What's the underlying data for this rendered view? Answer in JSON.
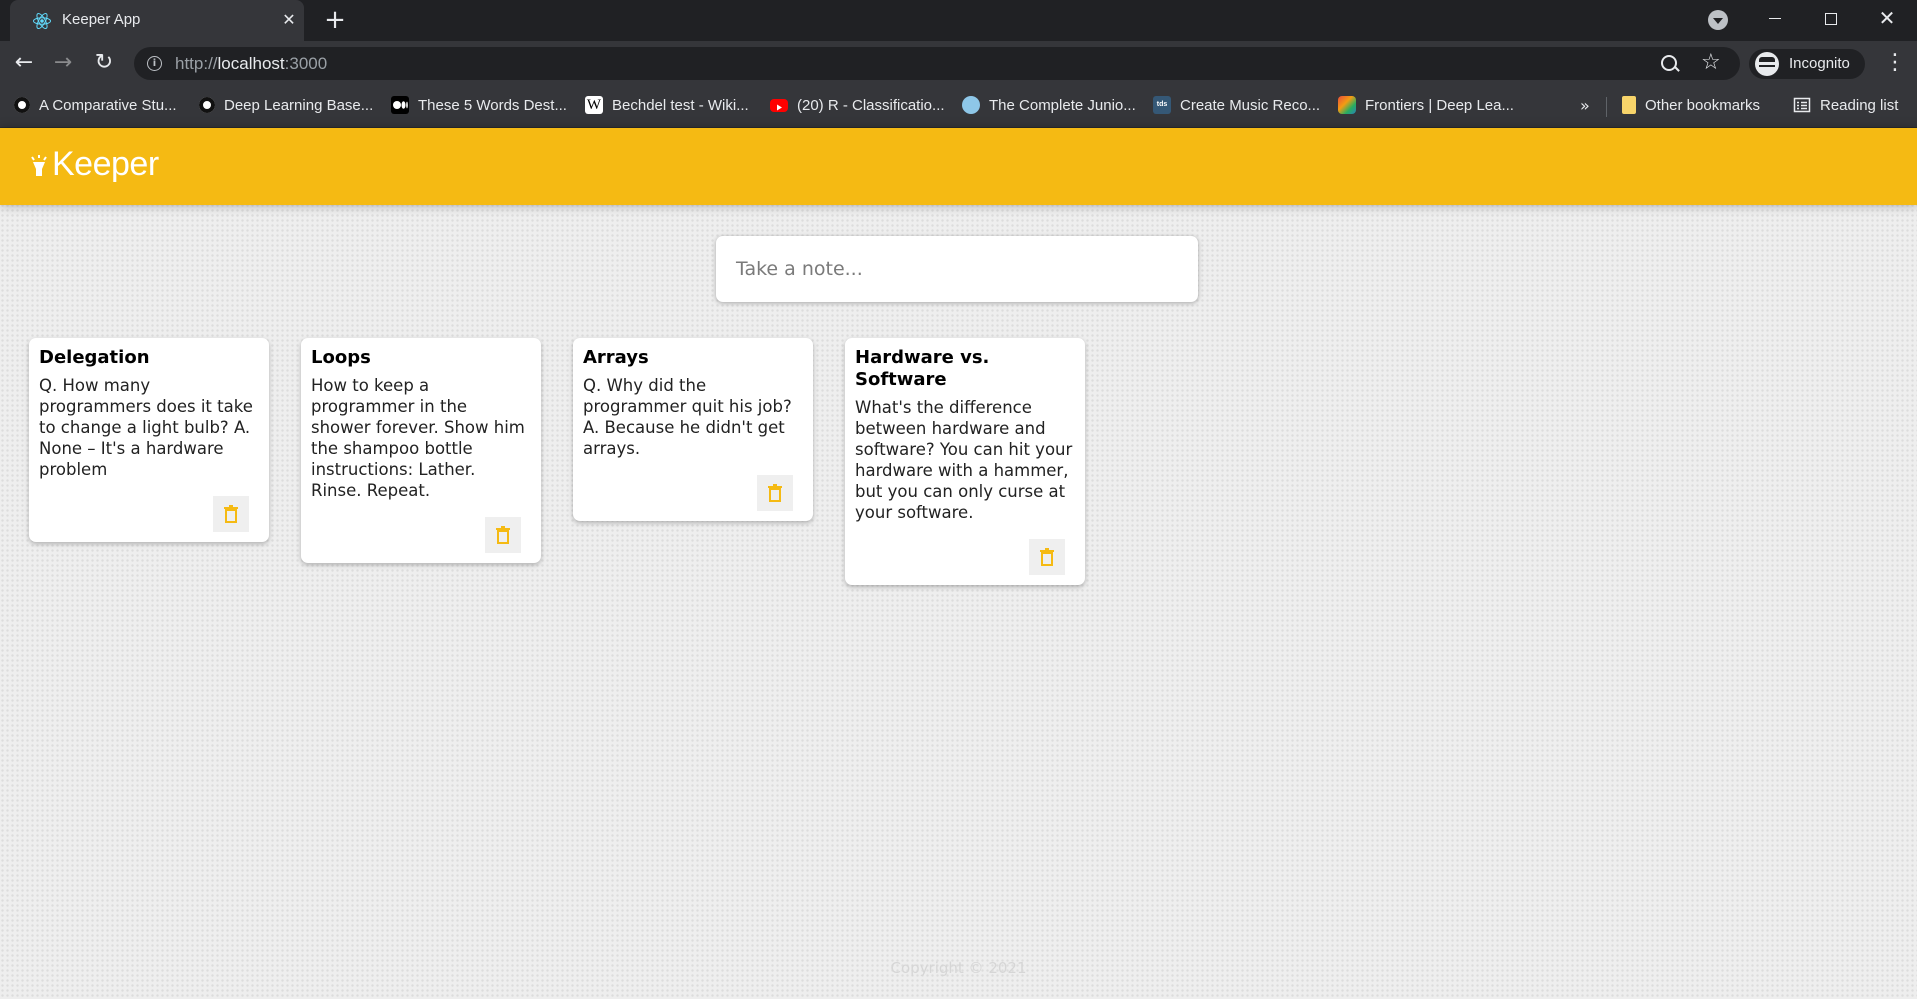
{
  "browser": {
    "tab_title": "Keeper App",
    "url_scheme": "http://",
    "url_host": "localhost",
    "url_port": ":3000",
    "profile_label": "Incognito",
    "bookmarks": [
      {
        "label": "A Comparative Stu...",
        "icon": "openai-icon"
      },
      {
        "label": "Deep Learning Base...",
        "icon": "openai-icon"
      },
      {
        "label": "These 5 Words Dest...",
        "icon": "medium-icon"
      },
      {
        "label": "Bechdel test - Wiki...",
        "icon": "wikipedia-icon"
      },
      {
        "label": "(20) R - Classificatio...",
        "icon": "youtube-icon"
      },
      {
        "label": "The Complete Junio...",
        "icon": "cloud-icon"
      },
      {
        "label": "Create Music Reco...",
        "icon": "tds-icon"
      },
      {
        "label": "Frontiers | Deep Lea...",
        "icon": "frontiers-icon"
      }
    ],
    "more_bookmarks": "»",
    "other_bookmarks": "Other bookmarks",
    "reading_list": "Reading list"
  },
  "app": {
    "logo_text": "Keeper",
    "input_placeholder": "Take a note...",
    "footer": "Copyright © 2021",
    "accent_color": "#f5ba13"
  },
  "notes": [
    {
      "title": "Delegation",
      "content": "Q. How many programmers does it take to change a light bulb? A. None – It's a hardware problem"
    },
    {
      "title": "Loops",
      "content": "How to keep a programmer in the shower forever. Show him the shampoo bottle instructions: Lather. Rinse. Repeat."
    },
    {
      "title": "Arrays",
      "content": "Q. Why did the programmer quit his job? A. Because he didn't get arrays."
    },
    {
      "title": "Hardware vs. Software",
      "content": "What's the difference between hardware and software? You can hit your hardware with a hammer, but you can only curse at your software."
    }
  ]
}
